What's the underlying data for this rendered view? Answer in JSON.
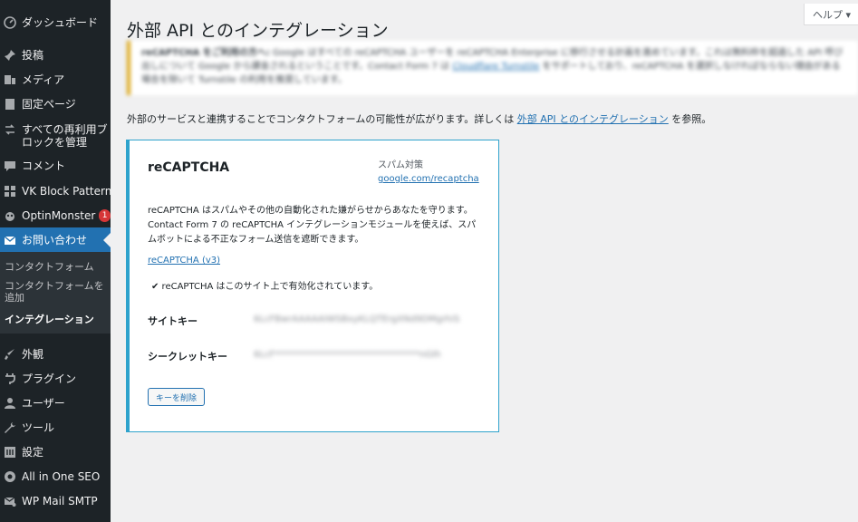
{
  "sidebar": {
    "items": [
      {
        "label": "ダッシュボード",
        "icon": "dashboard-icon"
      },
      {
        "label": "投稿",
        "icon": "pin-icon"
      },
      {
        "label": "メディア",
        "icon": "media-icon"
      },
      {
        "label": "固定ページ",
        "icon": "page-icon"
      },
      {
        "label": "すべての再利用ブ\nロックを管理",
        "icon": "reusable-block-icon"
      },
      {
        "label": "コメント",
        "icon": "comment-icon"
      },
      {
        "label": "VK Block Patterns",
        "icon": "grid-icon"
      },
      {
        "label": "OptinMonster",
        "icon": "optinmonster-icon",
        "badge": "1"
      },
      {
        "label": "お問い合わせ",
        "icon": "mail-icon"
      },
      {
        "label": "外観",
        "icon": "brush-icon"
      },
      {
        "label": "プラグイン",
        "icon": "plugin-icon"
      },
      {
        "label": "ユーザー",
        "icon": "user-icon"
      },
      {
        "label": "ツール",
        "icon": "wrench-icon"
      },
      {
        "label": "設定",
        "icon": "settings-icon"
      },
      {
        "label": "All in One SEO",
        "icon": "aioseo-icon"
      },
      {
        "label": "WP Mail SMTP",
        "icon": "smtp-icon"
      }
    ],
    "submenu": [
      {
        "label": "コンタクトフォーム"
      },
      {
        "label": "コンタクトフォームを\n追加"
      },
      {
        "label": "インテグレーション"
      }
    ]
  },
  "header": {
    "help_label": "ヘルプ ▾",
    "title": "外部 API とのインテグレーション"
  },
  "notice": {
    "bold": "reCAPTCHA をご利用の方へ:",
    "text1": " Google はすべての reCAPTCHA ユーザーを reCAPTCHA Enterprise に移行させる計画を進めています。これは無料枠を超過した API 呼び出しについて Google から課金されるということです。Contact Form 7 は ",
    "link": "Cloudflare Turnstile",
    "text2": " をサポートしており、reCAPTCHA を選択しなければならない理由がある場合を除いて Turnstile の利用を推奨しています。"
  },
  "intro": {
    "before": "外部のサービスと連携することでコンタクトフォームの可能性が広がります。詳しくは ",
    "link": "外部 API とのインテグレーション",
    "after": " を参照。"
  },
  "card": {
    "title": "reCAPTCHA",
    "category": "スパム対策",
    "site_link": "google.com/recaptcha",
    "description": "reCAPTCHA はスパムやその他の自動化された嫌がらせからあなたを守ります。Contact Form 7 の reCAPTCHA インテグレーションモジュールを使えば、スパムボットによる不正なフォーム送信を遮断できます。",
    "version_link": "reCAPTCHA (v3)",
    "status": "✔ reCAPTCHA はこのサイト上で有効化されています。",
    "site_key_label": "サイトキー",
    "site_key_value": "6LcFBwrAAAAAIWSBxyKLQTErgXNd9DMgrhiS",
    "secret_key_label": "シークレットキー",
    "secret_key_value": "6LcF********************************nGIh",
    "delete_button": "キーを削除"
  }
}
